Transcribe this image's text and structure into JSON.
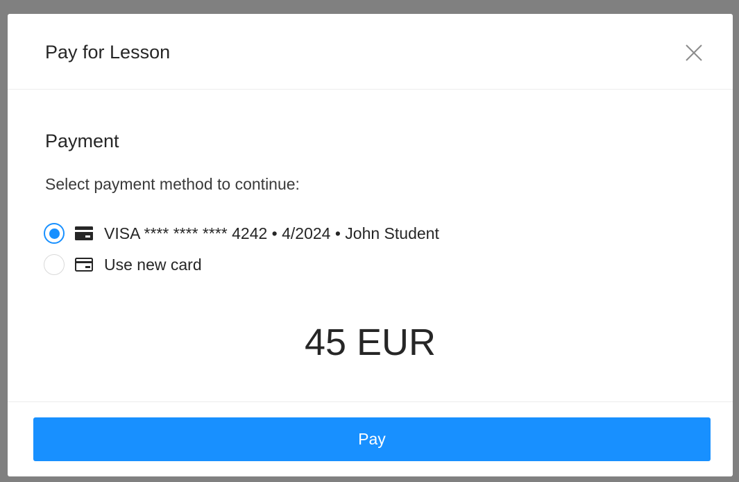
{
  "modal": {
    "title": "Pay for Lesson",
    "close_icon": "close-icon"
  },
  "payment": {
    "heading": "Payment",
    "instruction": "Select payment method to continue:",
    "options": [
      {
        "label": "VISA **** **** **** 4242 • 4/2024 • John Student",
        "icon": "credit-card-filled-icon",
        "selected": true
      },
      {
        "label": "Use new card",
        "icon": "credit-card-outline-icon",
        "selected": false
      }
    ],
    "amount": "45 EUR"
  },
  "footer": {
    "pay_label": "Pay"
  },
  "colors": {
    "primary": "#1890ff",
    "backdrop": "#808080",
    "text": "#262626"
  }
}
